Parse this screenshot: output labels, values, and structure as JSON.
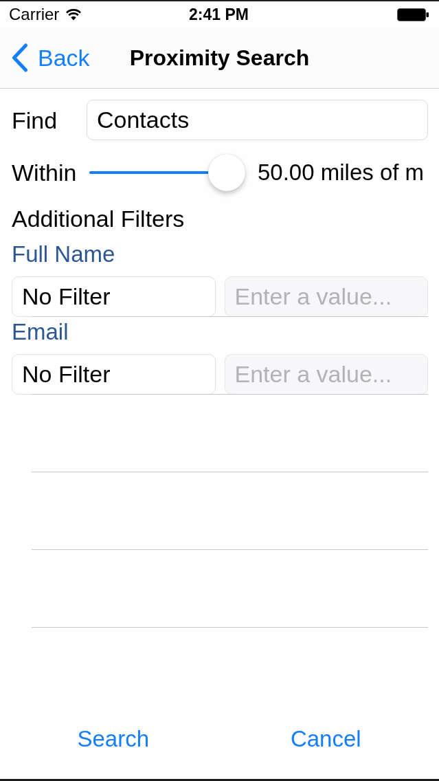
{
  "status_bar": {
    "carrier": "Carrier",
    "time": "2:41 PM"
  },
  "nav_bar": {
    "back": "Back",
    "title": "Proximity Search"
  },
  "find": {
    "label": "Find",
    "value": "Contacts"
  },
  "within": {
    "label": "Within",
    "level": 1,
    "reading": "50.00 miles of m"
  },
  "filters_heading": "Additional Filters",
  "filters": [
    {
      "field": "Full Name",
      "operator": "No Filter",
      "placeholder": "Enter a value..."
    },
    {
      "field": "Email",
      "operator": "No Filter",
      "placeholder": "Enter a value..."
    }
  ],
  "buttons": [
    "Search",
    "Cancel"
  ]
}
